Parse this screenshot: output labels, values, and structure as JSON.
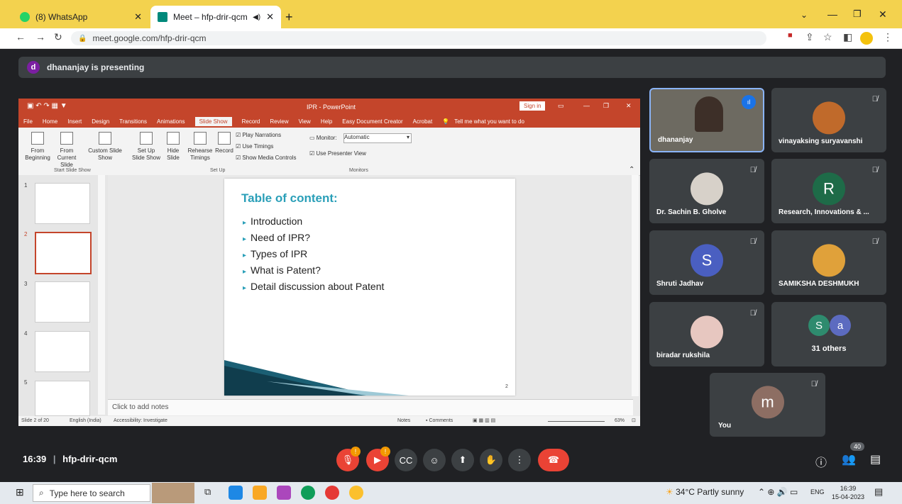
{
  "browser": {
    "tabs": [
      {
        "title": "(8) WhatsApp"
      },
      {
        "title": "Meet – hfp-drir-qcm"
      }
    ],
    "url": "meet.google.com/hfp-drir-qcm"
  },
  "meet": {
    "presenting_avatar": "d",
    "presenting_text": "dhananjay is presenting",
    "time": "16:39",
    "code": "hfp-drir-qcm",
    "people_count": "40",
    "tiles": [
      {
        "name": "dhananjay",
        "avatar": ""
      },
      {
        "name": "vinayaksing suryavanshi",
        "avatar": ""
      },
      {
        "name": "Dr. Sachin B. Gholve",
        "avatar": ""
      },
      {
        "name": "Research, Innovations & ...",
        "avatar": "R"
      },
      {
        "name": "Shruti Jadhav",
        "avatar": "S"
      },
      {
        "name": "SAMIKSHA DESHMUKH",
        "avatar": ""
      },
      {
        "name": "biradar rukshila",
        "avatar": ""
      },
      {
        "name": "31 others",
        "avatar1": "S",
        "avatar2": "a"
      },
      {
        "name": "You",
        "avatar": "m"
      }
    ]
  },
  "ppt": {
    "title": "IPR - PowerPoint",
    "sign_in": "Sign in",
    "menu": [
      "File",
      "Home",
      "Insert",
      "Design",
      "Transitions",
      "Animations",
      "Slide Show",
      "Record",
      "Review",
      "View",
      "Help",
      "Easy Document Creator",
      "Acrobat"
    ],
    "tell_me": "Tell me what you want to do",
    "ribbon": {
      "from_beginning": "From Beginning",
      "from_current": "From Current Slide",
      "custom_show": "Custom Slide Show",
      "group_start": "Start Slide Show",
      "setup_show": "Set Up Slide Show",
      "hide_slide": "Hide Slide",
      "rehearse": "Rehearse Timings",
      "record": "Record",
      "play_narrations": "Play Narrations",
      "use_timings": "Use Timings",
      "show_media": "Show Media Controls",
      "group_setup": "Set Up",
      "monitor_label": "Monitor:",
      "monitor_value": "Automatic",
      "presenter_view": "Use Presenter View",
      "group_monitors": "Monitors"
    },
    "slide": {
      "title": "Table of content:",
      "bullets": [
        "Introduction",
        "Need of IPR?",
        "Types of IPR",
        "What is Patent?",
        "Detail discussion about Patent"
      ],
      "number": "2"
    },
    "thumb_numbers": [
      "1",
      "2",
      "3",
      "4",
      "5"
    ],
    "notes_placeholder": "Click to add notes",
    "status": {
      "slide_of": "Slide 2 of 20",
      "language": "English (India)",
      "accessibility": "Accessibility: Investigate",
      "notes": "Notes",
      "comments": "Comments",
      "zoom": "63%"
    }
  },
  "taskbar": {
    "search_placeholder": "Type here to search",
    "weather": "34°C  Partly sunny",
    "lang": "ENG",
    "time": "16:39",
    "date": "15-04-2023"
  },
  "colors": {
    "ppt_accent": "#c4452b",
    "meet_bg": "#202124",
    "chrome_yellow": "#f3d24e",
    "end_call": "#ea4335"
  }
}
